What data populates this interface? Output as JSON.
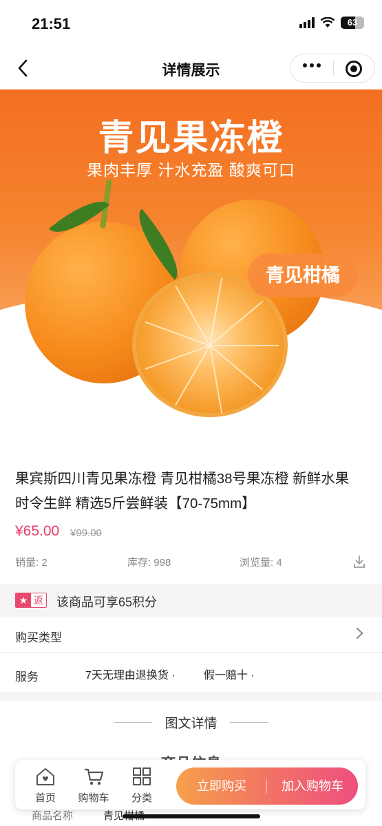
{
  "status_bar": {
    "time": "21:51",
    "battery": "63",
    "battery_level": 0.63
  },
  "nav": {
    "title": "详情展示"
  },
  "hero": {
    "title": "青见果冻橙",
    "subtitle": "果肉丰厚 汁水充盈 酸爽可口",
    "badge": "青见柑橘",
    "carousel_index": 1,
    "carousel_total": 1
  },
  "product": {
    "title": "果宾斯四川青见果冻橙 青见柑橘38号果冻橙 新鲜水果 时令生鲜 精选5斤尝鲜装【70-75mm】",
    "price": "¥65.00",
    "original_price": "¥99.00",
    "sales": "销量: 2",
    "stock": "库存: 998",
    "views": "浏览量: 4"
  },
  "points": {
    "tag": "返",
    "text": "该商品可享65积分"
  },
  "purchase_type": {
    "label": "购买类型"
  },
  "service": {
    "label": "服务",
    "items": [
      "7天无理由退换货 ·",
      "假一赔十 ·"
    ]
  },
  "details": {
    "title": "图文详情",
    "heading": "商品信息",
    "name_label": "商品名称",
    "name_value": "青见柑橘"
  },
  "tabbar": {
    "home": "首页",
    "cart": "购物车",
    "category": "分类",
    "buy_now": "立即购买",
    "add_cart": "加入购物车"
  },
  "colors": {
    "accent": "#e63c6a",
    "hero_orange": "#f36f21",
    "button_start": "#f6a04a",
    "button_end": "#ee4f7d"
  }
}
